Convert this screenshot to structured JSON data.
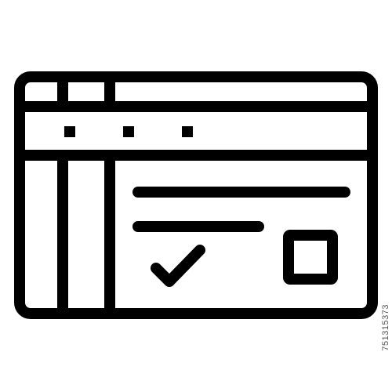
{
  "icon": {
    "name": "web-form-window-icon",
    "stroke_color": "#000000",
    "background_color": "#ffffff"
  },
  "watermark": {
    "id_text": "751315373"
  }
}
